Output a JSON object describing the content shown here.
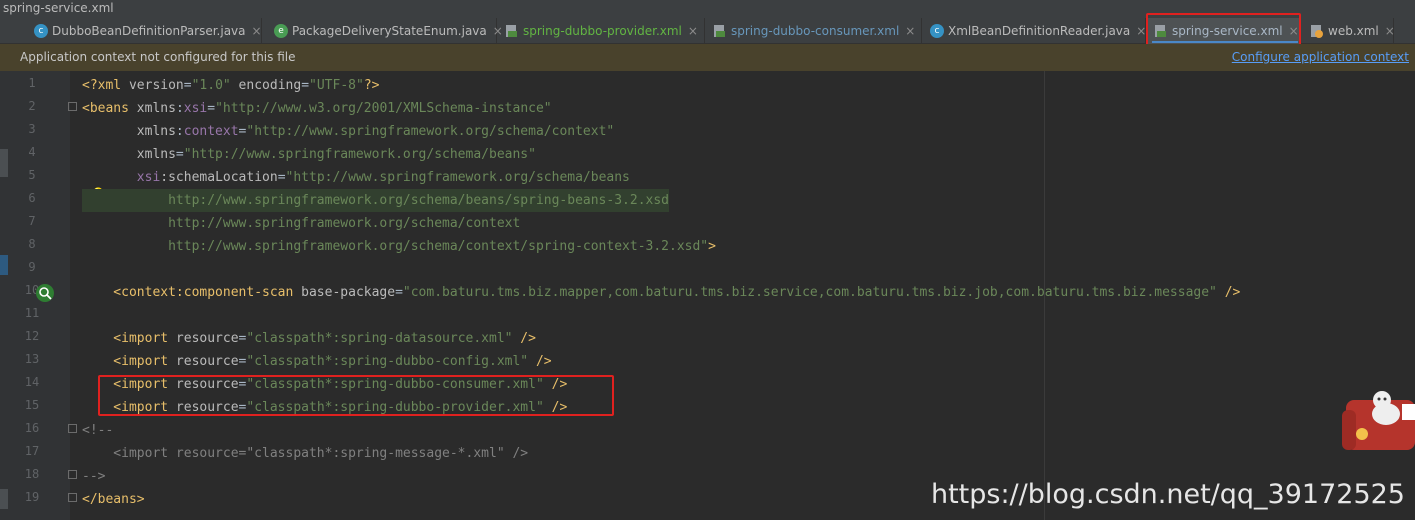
{
  "window": {
    "title": "spring-service.xml"
  },
  "tabs": [
    {
      "label": "DubboBeanDefinitionParser.java",
      "icon": "c-class-icon"
    },
    {
      "label": "PackageDeliveryStateEnum.java",
      "icon": "e-enum-icon"
    },
    {
      "label": "spring-dubbo-provider.xml",
      "icon": "xml-file-icon"
    },
    {
      "label": "spring-dubbo-consumer.xml",
      "icon": "xml-file-icon"
    },
    {
      "label": "XmlBeanDefinitionReader.java",
      "icon": "c-class-icon"
    },
    {
      "label": "spring-service.xml",
      "icon": "xml-file-icon",
      "active": true
    },
    {
      "label": "web.xml",
      "icon": "web-xml-icon"
    }
  ],
  "close_glyph": "×",
  "banner": {
    "message": "Application context not configured for this file",
    "link": "Configure application context"
  },
  "line_numbers": [
    "1",
    "2",
    "3",
    "4",
    "5",
    "6",
    "7",
    "8",
    "9",
    "10",
    "11",
    "12",
    "13",
    "14",
    "15",
    "16",
    "17",
    "18",
    "19"
  ],
  "code": {
    "l1": {
      "a": "<?",
      "b": "xml ",
      "c": "version",
      "d": "=",
      "e": "\"1.0\"",
      "f": " encoding",
      "g": "=",
      "h": "\"UTF-8\"",
      "i": "?>"
    },
    "l2": {
      "a": "<beans ",
      "b": "xmlns",
      "c": ":",
      "d": "xsi",
      "e": "=",
      "f": "\"http://www.w3.org/2001/XMLSchema-instance\""
    },
    "l3": {
      "a": "       xmlns",
      "b": ":",
      "c": "context",
      "d": "=",
      "e": "\"http://www.springframework.org/schema/context\""
    },
    "l4": {
      "a": "       xmlns",
      "b": "=",
      "c": "\"http://www.springframework.org/schema/beans\""
    },
    "l5": {
      "a": "       ",
      "b": "xsi",
      "c": ":schemaLocation",
      "d": "=",
      "e": "\"http://www.springframework.org/schema/beans"
    },
    "l6": "           http://www.springframework.org/schema/beans/spring-beans-3.2.xsd",
    "l7": "           http://www.springframework.org/schema/context",
    "l8": {
      "a": "           http://www.springframework.org/schema/context/spring-context-3.2.xsd\"",
      "b": ">"
    },
    "l10": {
      "a": "    <context",
      "b": ":",
      "c": "component-scan ",
      "d": "base-package",
      "e": "=",
      "f": "\"com.baturu.tms.biz.mapper,com.baturu.tms.biz.service,com.baturu.tms.biz.job,com.baturu.tms.biz.message\"",
      "g": " />"
    },
    "l12": {
      "a": "    <import ",
      "b": "resource",
      "c": "=",
      "d": "\"classpath*:spring-datasource.xml\"",
      "e": " />"
    },
    "l13": {
      "a": "    <import ",
      "b": "resource",
      "c": "=",
      "d": "\"classpath*:spring-dubbo-config.xml\"",
      "e": " />"
    },
    "l14": {
      "a": "    <import ",
      "b": "resource",
      "c": "=",
      "d": "\"classpath*:spring-dubbo-consumer.xml\"",
      "e": " />"
    },
    "l15": {
      "a": "    <import ",
      "b": "resource",
      "c": "=",
      "d": "\"classpath*:spring-dubbo-provider.xml\"",
      "e": " />"
    },
    "l16": "<!--",
    "l17": "    <import resource=\"classpath*:spring-message-*.xml\" />",
    "l18": "-->",
    "l19": "</beans>"
  },
  "watermark": "https://blog.csdn.net/qq_39172525",
  "colors": {
    "highlight_box": "#e0211f",
    "tag": "#e8bf6a",
    "string": "#6a8759",
    "namespace": "#9876aa",
    "comment": "#808080",
    "link": "#589df6"
  }
}
